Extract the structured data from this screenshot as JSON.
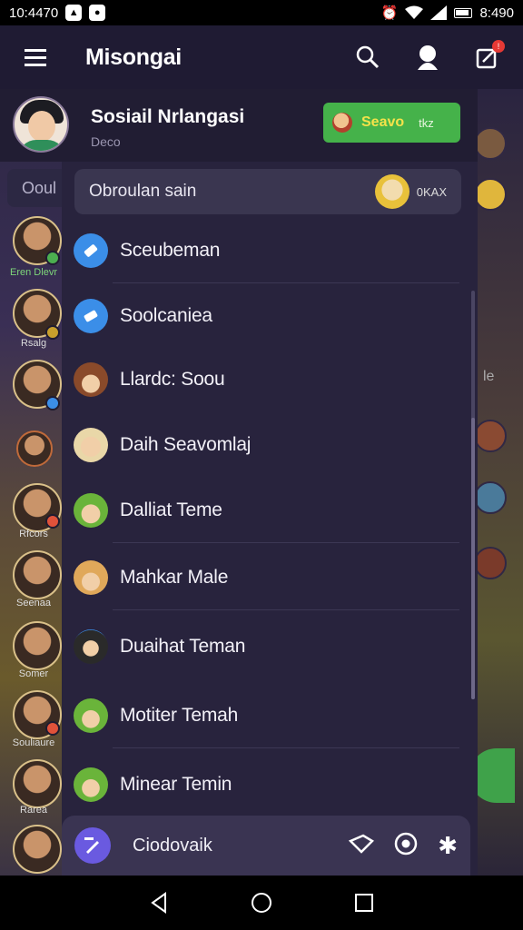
{
  "status_bar": {
    "time": "10:4470",
    "clock_right": "8:490"
  },
  "app_bar": {
    "title": "Misongai"
  },
  "profile": {
    "name": "Sosiail Nrlangasi",
    "subtitle": "Deco",
    "action_label": "Seavo",
    "action_sub": "tkz"
  },
  "left_column": {
    "tab_label": "Ooul",
    "captions": [
      "Eren Dlevr",
      "Rsalg",
      "",
      "",
      "Rfcors",
      "Seenaa",
      "Somer",
      "Souliaure",
      "Rarea",
      ""
    ]
  },
  "drawer": {
    "search": {
      "label": "Obroulan sain",
      "right_text": "0KAX"
    },
    "items": [
      {
        "label": "Sceubeman",
        "icon": "ticket-icon"
      },
      {
        "label": "Soolcaniea",
        "icon": "ticket-icon"
      },
      {
        "label": "Llardc: Soou",
        "icon": "avatar"
      },
      {
        "label": "Daih Seavomlaj",
        "icon": "avatar"
      },
      {
        "label": "Dalliat Teme",
        "icon": "avatar"
      },
      {
        "label": "Mahkar Male",
        "icon": "avatar"
      },
      {
        "label": "Duaihat Teman",
        "icon": "avatar"
      },
      {
        "label": "Motiter Temah",
        "icon": "avatar"
      },
      {
        "label": "Minear Temin",
        "icon": "avatar"
      }
    ],
    "bottom": {
      "label": "Ciodovaik"
    }
  },
  "right_column": {
    "side_letter": "le"
  },
  "colors": {
    "app_bar": "#1f1b33",
    "drawer": "#28233d",
    "accent_green": "#45b24a",
    "accent_blue": "#3b8ee8",
    "accent_purple": "#6a5ae0"
  }
}
